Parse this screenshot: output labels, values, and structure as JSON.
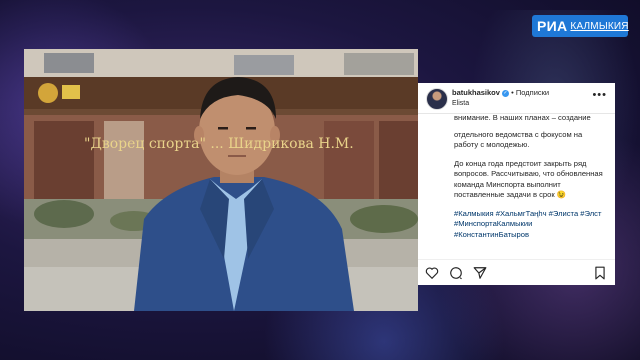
{
  "logo": {
    "brand": "РИА",
    "region": "КАЛМЫКИЯ"
  },
  "photo": {
    "sign_text": "\"Дворец спорта\" ... Шидрикова Н.М.",
    "alt": "man in blue suit in front of building"
  },
  "instagram": {
    "username": "batukhasikov",
    "follow_label": "Подписки",
    "location": "Elista",
    "more_icon": "more-icon",
    "cut_line": "внимание. В наших планах – создание",
    "paragraph1": "отдельного ведомства с фокусом на работу с молодежью.",
    "paragraph2": "До конца года предстоит закрыть ряд вопросов. Рассчитываю, что обновленная команда Минспорта выполнит поставленные задачи в срок 😉",
    "hashtags": "#Калмыкия #ХальмгТаңһч #Элиста #Элст #МинспортаКалмыкии #КонстантинБатыров",
    "actions": [
      "heart-icon",
      "comment-icon",
      "share-icon",
      "bookmark-icon"
    ]
  },
  "colors": {
    "logo_bg": "#1f78d6",
    "verified": "#3897f0",
    "hashtag": "#00376b",
    "background": "#1c1640"
  }
}
